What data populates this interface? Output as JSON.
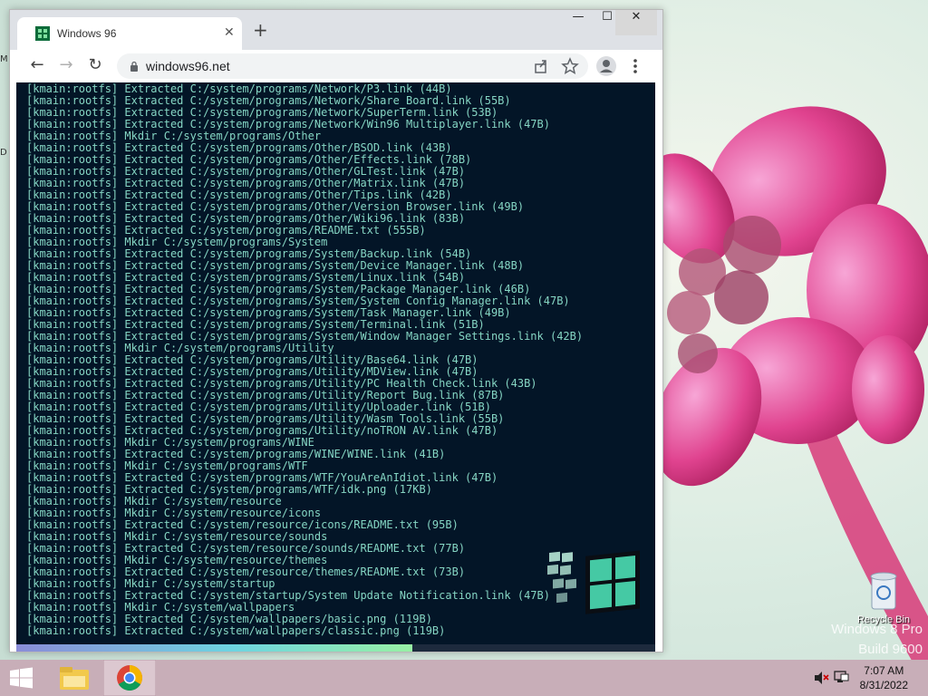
{
  "desktop": {
    "left_fragments": [
      "M",
      "D"
    ],
    "recycle_bin_label": "Recycle Bin",
    "watermark_line1": "Windows 8 Pro",
    "watermark_line2": "Build 9600"
  },
  "browser": {
    "tab_title": "Windows 96",
    "new_tab_label": "+",
    "url": "windows96.net",
    "icons": [
      "back-icon",
      "forward-icon",
      "reload-icon",
      "lock-icon",
      "share-icon",
      "bookmark-star-icon",
      "profile-icon",
      "menu-icon"
    ]
  },
  "terminal": {
    "lines": [
      "[kmain:rootfs] Extracted C:/system/programs/Network/P3.link (44B)",
      "[kmain:rootfs] Extracted C:/system/programs/Network/Share Board.link (55B)",
      "[kmain:rootfs] Extracted C:/system/programs/Network/SuperTerm.link (53B)",
      "[kmain:rootfs] Extracted C:/system/programs/Network/Win96 Multiplayer.link (47B)",
      "[kmain:rootfs] Mkdir C:/system/programs/Other",
      "[kmain:rootfs] Extracted C:/system/programs/Other/BSOD.link (43B)",
      "[kmain:rootfs] Extracted C:/system/programs/Other/Effects.link (78B)",
      "[kmain:rootfs] Extracted C:/system/programs/Other/GLTest.link (47B)",
      "[kmain:rootfs] Extracted C:/system/programs/Other/Matrix.link (47B)",
      "[kmain:rootfs] Extracted C:/system/programs/Other/Tips.link (42B)",
      "[kmain:rootfs] Extracted C:/system/programs/Other/Version Browser.link (49B)",
      "[kmain:rootfs] Extracted C:/system/programs/Other/Wiki96.link (83B)",
      "[kmain:rootfs] Extracted C:/system/programs/README.txt (555B)",
      "[kmain:rootfs] Mkdir C:/system/programs/System",
      "[kmain:rootfs] Extracted C:/system/programs/System/Backup.link (54B)",
      "[kmain:rootfs] Extracted C:/system/programs/System/Device Manager.link (48B)",
      "[kmain:rootfs] Extracted C:/system/programs/System/Linux.link (54B)",
      "[kmain:rootfs] Extracted C:/system/programs/System/Package Manager.link (46B)",
      "[kmain:rootfs] Extracted C:/system/programs/System/System Config Manager.link (47B)",
      "[kmain:rootfs] Extracted C:/system/programs/System/Task Manager.link (49B)",
      "[kmain:rootfs] Extracted C:/system/programs/System/Terminal.link (51B)",
      "[kmain:rootfs] Extracted C:/system/programs/System/Window Manager Settings.link (42B)",
      "[kmain:rootfs] Mkdir C:/system/programs/Utility",
      "[kmain:rootfs] Extracted C:/system/programs/Utility/Base64.link (47B)",
      "[kmain:rootfs] Extracted C:/system/programs/Utility/MDView.link (47B)",
      "[kmain:rootfs] Extracted C:/system/programs/Utility/PC Health Check.link (43B)",
      "[kmain:rootfs] Extracted C:/system/programs/Utility/Report Bug.link (87B)",
      "[kmain:rootfs] Extracted C:/system/programs/Utility/Uploader.link (51B)",
      "[kmain:rootfs] Extracted C:/system/programs/Utility/Wasm Tools.link (55B)",
      "[kmain:rootfs] Extracted C:/system/programs/Utility/noTRON AV.link (47B)",
      "[kmain:rootfs] Mkdir C:/system/programs/WINE",
      "[kmain:rootfs] Extracted C:/system/programs/WINE/WINE.link (41B)",
      "[kmain:rootfs] Mkdir C:/system/programs/WTF",
      "[kmain:rootfs] Extracted C:/system/programs/WTF/YouAreAnIdiot.link (47B)",
      "[kmain:rootfs] Extracted C:/system/programs/WTF/idk.png (17KB)",
      "[kmain:rootfs] Mkdir C:/system/resource",
      "[kmain:rootfs] Mkdir C:/system/resource/icons",
      "[kmain:rootfs] Extracted C:/system/resource/icons/README.txt (95B)",
      "[kmain:rootfs] Mkdir C:/system/resource/sounds",
      "[kmain:rootfs] Extracted C:/system/resource/sounds/README.txt (77B)",
      "[kmain:rootfs] Mkdir C:/system/resource/themes",
      "[kmain:rootfs] Extracted C:/system/resource/themes/README.txt (73B)",
      "[kmain:rootfs] Mkdir C:/system/startup",
      "[kmain:rootfs] Extracted C:/system/startup/System Update Notification.link (47B)",
      "[kmain:rootfs] Mkdir C:/system/wallpapers",
      "[kmain:rootfs] Extracted C:/system/wallpapers/basic.png (119B)",
      "[kmain:rootfs] Extracted C:/system/wallpapers/classic.png (119B)"
    ],
    "progress_percent": 62
  },
  "taskbar": {
    "clock_time": "7:07 AM",
    "clock_date": "8/31/2022",
    "icons": [
      "windows-start-icon",
      "file-explorer-icon",
      "chrome-icon",
      "volume-muted-icon",
      "network-icon"
    ]
  },
  "colors": {
    "terminal_bg": "#031527",
    "terminal_text": "#86d6c4",
    "taskbar_bg": "#c8aeb8",
    "tab_strip": "#dee1e6"
  }
}
